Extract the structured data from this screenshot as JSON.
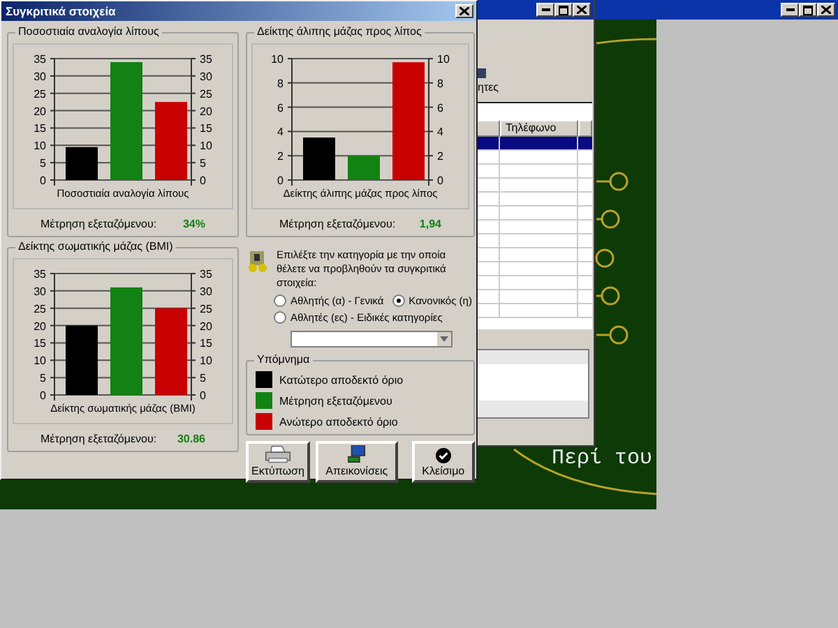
{
  "back_window": {
    "caption": "Περί του"
  },
  "middle_window": {
    "toolbar_caption": "ητες",
    "table": {
      "columns": [
        "Τηλέφωνο"
      ],
      "rows": [
        {
          "selected": true
        },
        {
          "selected": false
        },
        {
          "selected": false
        },
        {
          "selected": false
        },
        {
          "selected": false
        },
        {
          "selected": false
        },
        {
          "selected": false
        },
        {
          "selected": false
        },
        {
          "selected": false
        },
        {
          "selected": false
        },
        {
          "selected": false
        },
        {
          "selected": false
        },
        {
          "selected": false
        }
      ]
    }
  },
  "dialog": {
    "title": "Συγκριτικά στοιχεία",
    "charts": [
      {
        "title": "Ποσοστιαία αναλογία λίπους",
        "measure_label": "Μέτρηση εξεταζόμενου:",
        "measure_value": "34%",
        "chart_data": {
          "type": "bar",
          "grid": true,
          "xlabel": "Ποσοστιαία αναλογία λίπους",
          "ylim": [
            0,
            35
          ],
          "yticks": [
            0,
            5,
            10,
            15,
            20,
            25,
            30,
            35
          ],
          "y2lim": [
            0,
            35
          ],
          "y2ticks": [
            0,
            5,
            10,
            15,
            20,
            25,
            30,
            35
          ],
          "series": [
            {
              "color": "#000000",
              "values": [
                9.5
              ]
            },
            {
              "color": "#128212",
              "values": [
                34
              ]
            },
            {
              "color": "#c80000",
              "values": [
                22.5
              ]
            }
          ]
        }
      },
      {
        "title": "Δείκτης άλιπης μάζας προς λίπος",
        "measure_label": "Μέτρηση εξεταζόμενου:",
        "measure_value": "1,94",
        "chart_data": {
          "type": "bar",
          "grid": true,
          "xlabel": "Δείκτης άλιπης μάζας προς λίπος",
          "ylim": [
            0,
            10
          ],
          "yticks": [
            0,
            2,
            4,
            6,
            8,
            10
          ],
          "y2lim": [
            0,
            10
          ],
          "y2ticks": [
            0,
            2,
            4,
            6,
            8,
            10
          ],
          "series": [
            {
              "color": "#000000",
              "values": [
                3.5
              ]
            },
            {
              "color": "#128212",
              "values": [
                2
              ]
            },
            {
              "color": "#c80000",
              "values": [
                9.7
              ]
            }
          ]
        }
      },
      {
        "title": "Δείκτης σωματικής μάζας (BMI)",
        "measure_label": "Μέτρηση εξεταζόμενου:",
        "measure_value": "30.86",
        "chart_data": {
          "type": "bar",
          "grid": true,
          "xlabel": "Δείκτης σωματικής μάζας (BMI)",
          "ylim": [
            0,
            35
          ],
          "yticks": [
            0,
            5,
            10,
            15,
            20,
            25,
            30,
            35
          ],
          "y2lim": [
            0,
            35
          ],
          "y2ticks": [
            0,
            5,
            10,
            15,
            20,
            25,
            30,
            35
          ],
          "series": [
            {
              "color": "#000000",
              "values": [
                20
              ]
            },
            {
              "color": "#128212",
              "values": [
                31
              ]
            },
            {
              "color": "#c80000",
              "values": [
                25
              ]
            }
          ]
        }
      }
    ],
    "category": {
      "prompt": "Επιλέξτε την κατηγορία με την οποία θέλετε να προβληθούν τα συγκριτικά στοιχεία:",
      "options": [
        {
          "label": "Αθλητής (α) - Γενικά",
          "selected": false
        },
        {
          "label": "Κανονικός (η)",
          "selected": true
        },
        {
          "label": "Αθλητές (ες) - Ειδικές κατηγορίες",
          "selected": false
        }
      ]
    },
    "legend": {
      "title": "Υπόμνημα",
      "items": [
        {
          "label": "Κατώτερο αποδεκτό όριο",
          "color": "#000000"
        },
        {
          "label": "Μέτρηση εξεταζόμενου",
          "color": "#128212"
        },
        {
          "label": "Ανώτερο αποδεκτό όριο",
          "color": "#c80000"
        }
      ]
    },
    "buttons": [
      {
        "label": "Εκτύπωση",
        "kind": "print"
      },
      {
        "label": "Απεικονίσεις",
        "kind": "display"
      },
      {
        "label": "Κλείσιμο",
        "kind": "close"
      }
    ]
  }
}
